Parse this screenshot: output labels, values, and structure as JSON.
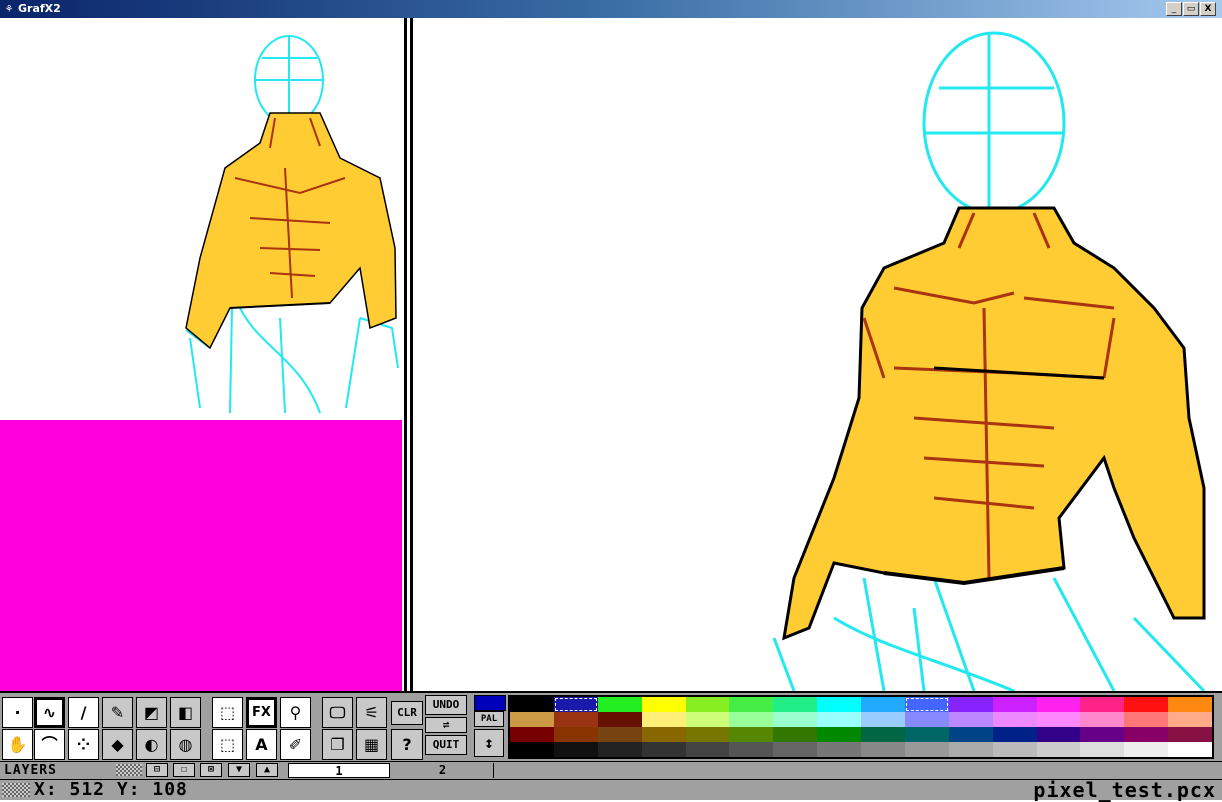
{
  "window": {
    "title": "GrafX2",
    "controls": [
      "_",
      "▭",
      "X"
    ]
  },
  "tools": {
    "row1": [
      {
        "name": "freehand-dot",
        "glyph": "·"
      },
      {
        "name": "freehand-curve",
        "glyph": "∿"
      },
      {
        "name": "line",
        "glyph": "/"
      },
      {
        "name": "airbrush-pen",
        "glyph": "✎"
      },
      {
        "name": "rectangle-filled",
        "glyph": "◩"
      },
      {
        "name": "rectangle-gradient",
        "glyph": "◧"
      },
      {
        "name": "brush-grab",
        "glyph": "⬚"
      },
      {
        "name": "effects",
        "glyph": "FX"
      },
      {
        "name": "magnifier",
        "glyph": "⚲"
      },
      {
        "name": "monitor",
        "glyph": "🖵"
      },
      {
        "name": "ruler",
        "glyph": "⚟"
      }
    ],
    "row2": [
      {
        "name": "hand",
        "glyph": "✋"
      },
      {
        "name": "curve",
        "glyph": "⌒"
      },
      {
        "name": "spray",
        "glyph": "⁘"
      },
      {
        "name": "fill-bucket",
        "glyph": "◆"
      },
      {
        "name": "circle-filled",
        "glyph": "◐"
      },
      {
        "name": "sphere",
        "glyph": "◍"
      },
      {
        "name": "polybrush",
        "glyph": "⬚"
      },
      {
        "name": "text",
        "glyph": "A"
      },
      {
        "name": "pipette",
        "glyph": "✐"
      },
      {
        "name": "copy-page",
        "glyph": "❐"
      },
      {
        "name": "grid",
        "glyph": "▦"
      }
    ],
    "help": "?",
    "clr": "CLR",
    "undo": "UNDO",
    "swap": "⇌",
    "quit": "QUIT",
    "pal": "PAL",
    "arrows": "↕"
  },
  "palette": {
    "foreground": "#0000bb",
    "colors": [
      "#000000",
      "#1a1aaa",
      "#22ee22",
      "#ffff00",
      "#88ee22",
      "#44ee44",
      "#22ee88",
      "#00ffff",
      "#22aaff",
      "#4466ff",
      "#8822ff",
      "#cc22ff",
      "#ff22ee",
      "#ff2288",
      "#ff1111",
      "#ff8811",
      "#cc9944",
      "#993311",
      "#661100",
      "#ffee77",
      "#ccff77",
      "#99ff99",
      "#99ffcc",
      "#99ffff",
      "#99ccff",
      "#8888ff",
      "#bb88ff",
      "#ee88ff",
      "#ff88ff",
      "#ff88cc",
      "#ff7777",
      "#ffaa88",
      "#770000",
      "#883300",
      "#774411",
      "#886600",
      "#777700",
      "#558800",
      "#337700",
      "#008800",
      "#006644",
      "#006666",
      "#004488",
      "#002288",
      "#330088",
      "#660088",
      "#880066",
      "#881144",
      "#000000",
      "#111111",
      "#222222",
      "#333333",
      "#444444",
      "#555555",
      "#666666",
      "#777777",
      "#888888",
      "#999999",
      "#aaaaaa",
      "#bbbbbb",
      "#cccccc",
      "#dddddd",
      "#eeeeee",
      "#ffffff"
    ],
    "highlighted": [
      1,
      9
    ]
  },
  "layers": {
    "label": "LAYERS",
    "buttons": [
      "⊟",
      "☐",
      "⊠",
      "▼",
      "▲"
    ],
    "tabs": [
      "1",
      "2"
    ]
  },
  "status": {
    "coords": "X:  512    Y:  108",
    "filename": "pixel_test.pcx"
  },
  "canvas": {
    "background": "#ffffff",
    "magenta": "#ff00dd",
    "skin": "#ffcc33",
    "shade": "#aa3311",
    "sketch": "#22e8f0"
  }
}
